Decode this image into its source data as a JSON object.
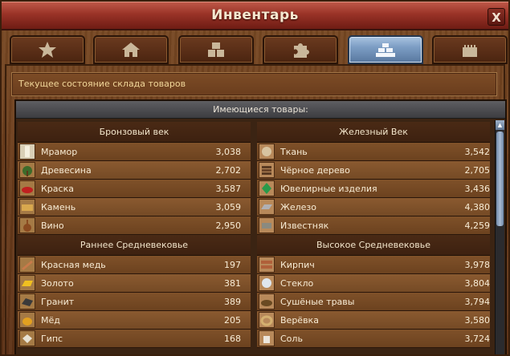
{
  "window": {
    "title": "Инвентарь",
    "close_label": "X"
  },
  "tabs": [
    {
      "icon": "star-icon"
    },
    {
      "icon": "house-icon"
    },
    {
      "icon": "crates-icon"
    },
    {
      "icon": "puzzle-icon"
    },
    {
      "icon": "goods-icon",
      "active": true
    },
    {
      "icon": "castle-icon"
    }
  ],
  "status": {
    "text": "Текущее состояние склада товаров"
  },
  "panel": {
    "header": "Имеющиеся товары:"
  },
  "sections": {
    "bronze": {
      "title": "Бронзовый век",
      "items": [
        {
          "name": "Мрамор",
          "value": "3,038"
        },
        {
          "name": "Древесина",
          "value": "2,702"
        },
        {
          "name": "Краска",
          "value": "3,587"
        },
        {
          "name": "Камень",
          "value": "3,059"
        },
        {
          "name": "Вино",
          "value": "2,950"
        }
      ]
    },
    "iron": {
      "title": "Железный Век",
      "items": [
        {
          "name": "Ткань",
          "value": "3,542"
        },
        {
          "name": "Чёрное дерево",
          "value": "2,705"
        },
        {
          "name": "Ювелирные изделия",
          "value": "3,436"
        },
        {
          "name": "Железо",
          "value": "4,380"
        },
        {
          "name": "Известняк",
          "value": "4,259"
        }
      ]
    },
    "early_middle": {
      "title": "Раннее Средневековье",
      "items": [
        {
          "name": "Красная медь",
          "value": "197"
        },
        {
          "name": "Золото",
          "value": "381"
        },
        {
          "name": "Гранит",
          "value": "389"
        },
        {
          "name": "Мёд",
          "value": "205"
        },
        {
          "name": "Гипс",
          "value": "168"
        }
      ]
    },
    "high_middle": {
      "title": "Высокое Средневековье",
      "items": [
        {
          "name": "Кирпич",
          "value": "3,978"
        },
        {
          "name": "Стекло",
          "value": "3,804"
        },
        {
          "name": "Сушёные травы",
          "value": "3,794"
        },
        {
          "name": "Верёвка",
          "value": "3,580"
        },
        {
          "name": "Соль",
          "value": "3,724"
        }
      ]
    }
  },
  "colors": {
    "title_bar": "#9a3327",
    "active_tab": "#7c9dc4",
    "text": "#f8ecd5",
    "status_text": "#f2d79a"
  }
}
